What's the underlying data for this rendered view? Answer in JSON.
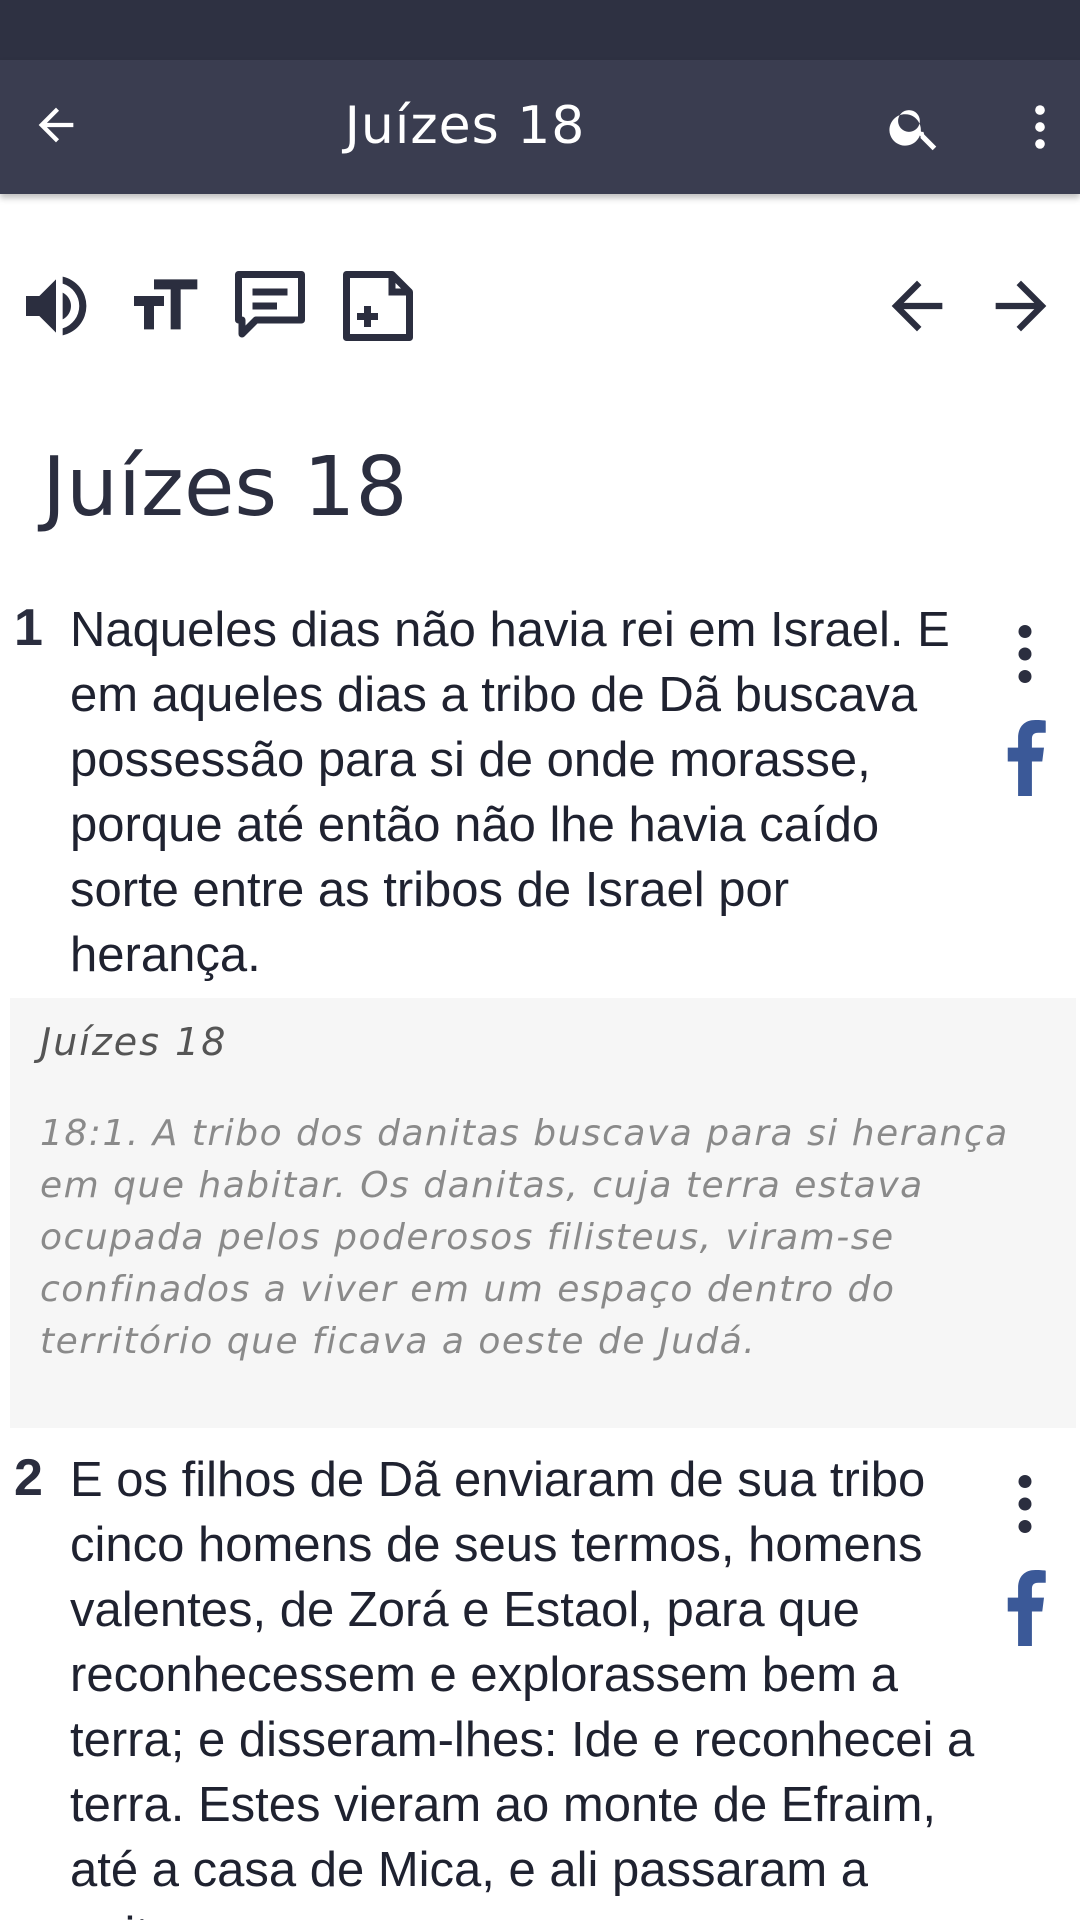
{
  "header": {
    "title": "Juízes 18",
    "back_icon": "arrow-left-icon",
    "search_icon": "search-icon",
    "menu_icon": "more-vert-icon"
  },
  "toolbar": {
    "icons": [
      "speaker-icon",
      "text-size-icon",
      "comment-icon",
      "add-note-icon"
    ],
    "nav_icons": [
      "prev-chapter-icon",
      "next-chapter-icon"
    ]
  },
  "chapter": {
    "title": "Juízes 18"
  },
  "verses": [
    {
      "number": "1",
      "text": "Naqueles dias não havia rei em Israel. E em aqueles dias a tribo de Dã buscava possessão para si de onde morasse, porque até então não lhe havia caído sorte entre as tribos de Israel por herança."
    },
    {
      "number": "2",
      "text": "E os filhos de Dã enviaram de sua tribo cinco homens de seus termos, homens valentes, de Zorá e Estaol, para que reconhecessem e explorassem bem a terra; e disseram-lhes: Ide e reconhecei a terra. Estes vieram ao monte de Efraim, até a casa de Mica, e ali passaram a noite."
    }
  ],
  "commentary": {
    "title": "Juízes 18",
    "text": "18:1. A tribo dos danitas buscava para si herança em que habitar. Os danitas, cuja terra estava ocupada pelos poderosos filisteus, viram-se confinados a viver em um espaço dentro do território que ficava a oeste de Judá."
  },
  "colors": {
    "app_bar": "#3a3d50",
    "status_bar": "#2e3142",
    "facebook": "#3b5998",
    "icon": "#2b2e3f"
  }
}
